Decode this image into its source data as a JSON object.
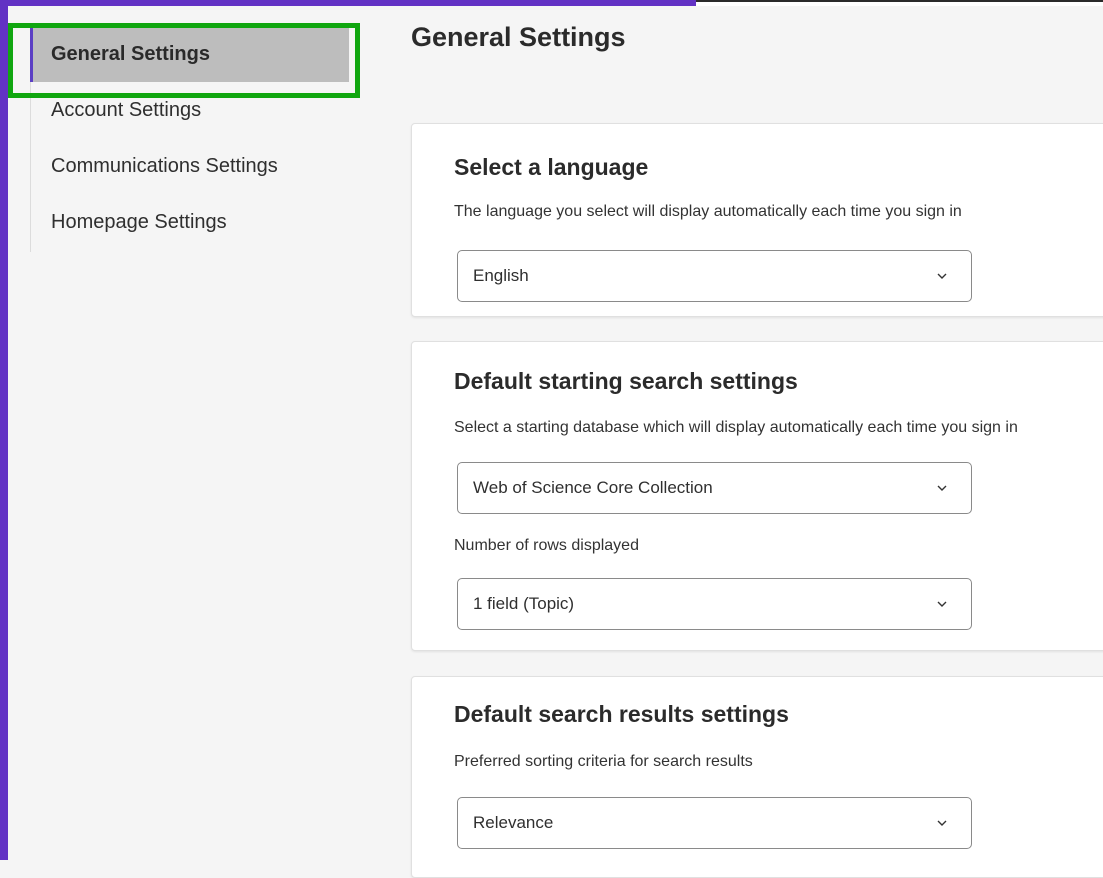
{
  "sidebar": {
    "items": [
      {
        "label": "General Settings",
        "active": true
      },
      {
        "label": "Account Settings",
        "active": false
      },
      {
        "label": "Communications Settings",
        "active": false
      },
      {
        "label": "Homepage Settings",
        "active": false
      }
    ]
  },
  "main": {
    "title": "General Settings",
    "language": {
      "heading": "Select a language",
      "description": "The language you select will display automatically each time you sign in",
      "selected": "English"
    },
    "search": {
      "heading": "Default starting search settings",
      "database_description": "Select a starting database which will display automatically each time you sign in",
      "database_selected": "Web of Science Core Collection",
      "rows_label": "Number of rows displayed",
      "rows_selected": "1 field (Topic)"
    },
    "results": {
      "heading": "Default search results settings",
      "sort_label": "Preferred sorting criteria for search results",
      "sort_selected": "Relevance"
    }
  },
  "icons": {
    "dropdown": "chevron-down-icon"
  },
  "colors": {
    "frame": "#6232c4",
    "highlight": "#10a60f",
    "active_bg": "#bdbdbd",
    "active_indicator": "#5b3fc4"
  }
}
